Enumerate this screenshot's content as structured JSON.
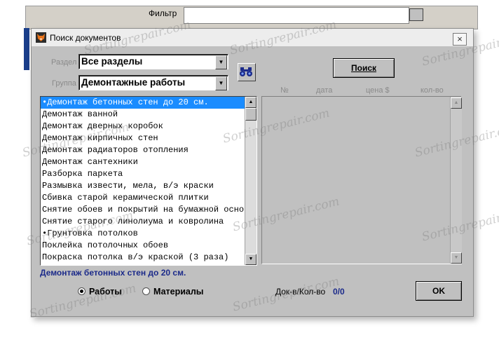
{
  "background_window": {
    "filter_label": "Фильтр"
  },
  "dialog": {
    "title": "Поиск документов",
    "close_label": "×",
    "section_label": "Раздел",
    "section_value": "Все разделы",
    "group_label": "Группа",
    "group_value": "Демонтажные работы",
    "search_button": "Поиск",
    "columns": [
      "№",
      "дата",
      "цена $",
      "кол-во"
    ],
    "works": [
      {
        "label": "•Демонтаж бетонных стен до 20 см.",
        "selected": true
      },
      {
        "label": "Демонтаж ванной",
        "selected": false
      },
      {
        "label": "Демонтаж дверных коробок",
        "selected": false
      },
      {
        "label": "Демонтаж кирпичных стен",
        "selected": false
      },
      {
        "label": "Демонтаж радиаторов отопления",
        "selected": false
      },
      {
        "label": "Демонтаж сантехники",
        "selected": false
      },
      {
        "label": "Разборка паркета",
        "selected": false
      },
      {
        "label": "Размывка извести, мела, в/э краски",
        "selected": false
      },
      {
        "label": "Сбивка старой керамической плитки",
        "selected": false
      },
      {
        "label": "Снятие обоев и покрытий на бумажной осно",
        "selected": false
      },
      {
        "label": "Снятие старого линолиума и ковролина",
        "selected": false
      },
      {
        "label": "•Грунтовка потолков",
        "selected": false
      },
      {
        "label": "Поклейка потолочных обоев",
        "selected": false
      },
      {
        "label": "Покраска потолка в/э краской (3 раза)",
        "selected": false
      }
    ],
    "selected_work": "Демонтаж бетонных стен до 20 см.",
    "radio_works": "Работы",
    "radio_materials": "Материалы",
    "radio_selected": "works",
    "count_label": "Док-в/Кол-во",
    "count_value": "0/0",
    "ok_button": "OK"
  },
  "watermark_text": "Sortingrepair.com",
  "icons": {
    "title": "fox-app-icon",
    "binoculars": "binoculars-icon",
    "dropdown": "chevron-down-icon"
  },
  "colors": {
    "dialog_bg": "#c0c0c0",
    "selection": "#1a8cff",
    "status_text": "#1b2a8a"
  }
}
